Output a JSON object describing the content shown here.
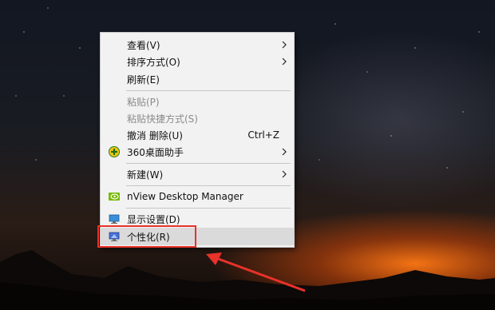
{
  "menu": {
    "items": [
      {
        "label": "查看(V)",
        "submenu": true
      },
      {
        "label": "排序方式(O)",
        "submenu": true
      },
      {
        "label": "刷新(E)"
      },
      {
        "label": "粘贴(P)",
        "disabled": true
      },
      {
        "label": "粘贴快捷方式(S)",
        "disabled": true
      },
      {
        "label": "撤消 删除(U)",
        "shortcut": "Ctrl+Z"
      },
      {
        "label": "360桌面助手",
        "icon": "360-assistant-icon",
        "submenu": true
      },
      {
        "label": "新建(W)",
        "submenu": true
      },
      {
        "label": "nView Desktop Manager",
        "icon": "nvidia-icon"
      },
      {
        "label": "显示设置(D)",
        "icon": "display-settings-icon"
      },
      {
        "label": "个性化(R)",
        "icon": "personalize-icon",
        "highlighted": true
      }
    ]
  },
  "colors": {
    "annotation": "#e8322a",
    "menu_bg": "#f2f2f2",
    "hover_bg": "#dadada",
    "disabled_text": "#8a8a8a"
  }
}
